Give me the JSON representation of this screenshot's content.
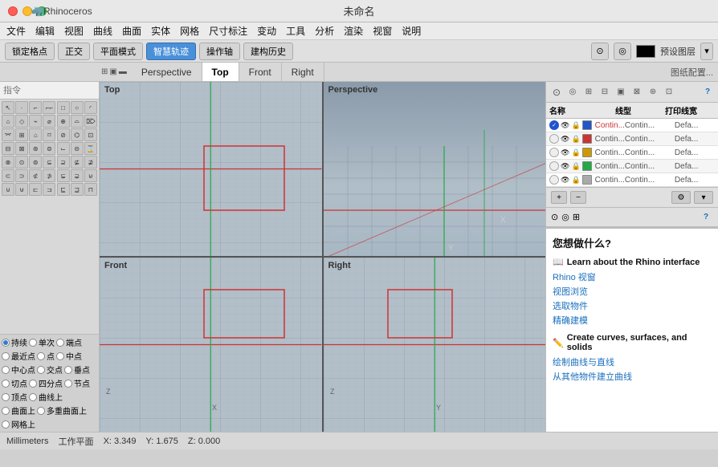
{
  "titlebar": {
    "app_name": "Rhinoceros",
    "title": "未命名"
  },
  "menu": {
    "items": [
      "文件",
      "编辑",
      "视图",
      "曲线",
      "曲面",
      "实体",
      "网格",
      "尺寸标注",
      "变动",
      "工具",
      "分析",
      "渲染",
      "视窗",
      "说明"
    ]
  },
  "toolbar": {
    "lock_grid": "锁定格点",
    "ortho": "正交",
    "plane_mode": "平面模式",
    "smart_track": "智慧轨迹",
    "op_axis": "操作轴",
    "build_history": "建构历史",
    "preset_label": "预设图层",
    "color_swatch": "#000000"
  },
  "viewport_tabs": {
    "tabs": [
      {
        "label": "Perspective",
        "active": false
      },
      {
        "label": "Top",
        "active": true
      },
      {
        "label": "Front",
        "active": false
      },
      {
        "label": "Right",
        "active": false
      }
    ],
    "settings_label": "图纸配置..."
  },
  "viewports": {
    "top_left": {
      "label": "Top",
      "active": true
    },
    "top_right": {
      "label": "Perspective",
      "active": false
    },
    "bottom_left": {
      "label": "Front",
      "active": false
    },
    "bottom_right": {
      "label": "Right",
      "active": false
    }
  },
  "command_input": {
    "placeholder": "指令"
  },
  "osnap": {
    "items": [
      {
        "label": "持续",
        "checked": true
      },
      {
        "label": "单次",
        "checked": false
      },
      {
        "label": "端点",
        "checked": false
      },
      {
        "label": "最近点",
        "checked": false
      },
      {
        "label": "点",
        "checked": false
      },
      {
        "label": "中点",
        "checked": false
      },
      {
        "label": "中心点",
        "checked": false
      },
      {
        "label": "交点",
        "checked": false
      },
      {
        "label": "垂点",
        "checked": false
      },
      {
        "label": "切点",
        "checked": false
      },
      {
        "label": "四分点",
        "checked": false
      },
      {
        "label": "节点",
        "checked": false
      },
      {
        "label": "顶点",
        "checked": false
      },
      {
        "label": "曲线上",
        "checked": false
      },
      {
        "label": "曲面上",
        "checked": false
      },
      {
        "label": "多重曲面上",
        "checked": false
      },
      {
        "label": "网格上",
        "checked": false
      }
    ]
  },
  "layer_panel": {
    "header": "名称",
    "col_line": "线型",
    "col_print": "打印线宽",
    "layers": [
      {
        "name": "Contin...",
        "color": "#2255cc",
        "line": "Contin...",
        "print": "Defa..."
      },
      {
        "name": "Contin...",
        "color": "#cc3333",
        "line": "Contin...",
        "print": "Defa..."
      },
      {
        "name": "Contin...",
        "color": "#cc9900",
        "line": "Contin...",
        "print": "Defa..."
      },
      {
        "name": "Contin...",
        "color": "#22aa44",
        "line": "Contin...",
        "print": "Defa..."
      },
      {
        "name": "Contin...",
        "color": "#aaaaaa",
        "line": "Contin...",
        "print": "Defa..."
      }
    ]
  },
  "help_panel": {
    "what_label": "您想做什么?",
    "section1_title": "Learn about the Rhino interface",
    "section1_links": [
      "Rhino 视窗",
      "视图浏览",
      "选取物件",
      "精确建模"
    ],
    "section2_title": "Create curves, surfaces, and solids",
    "section2_links": [
      "绘制曲线与直线",
      "从其他物件建立曲线"
    ]
  },
  "status_bar": {
    "unit": "Millimeters",
    "cplane": "工作平面",
    "x": "X: 3.349",
    "y": "Y: 1.675",
    "z": "Z: 0.000"
  }
}
